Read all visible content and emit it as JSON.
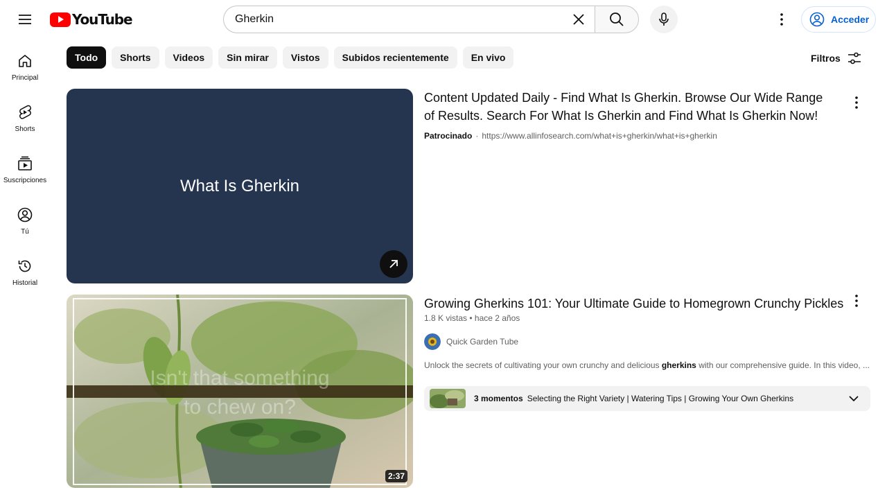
{
  "header": {
    "logo_text": "YouTube",
    "search": {
      "value": "Gherkin"
    },
    "signin_label": "Acceder"
  },
  "sidebar": {
    "items": [
      {
        "label": "Principal",
        "icon": "home-icon"
      },
      {
        "label": "Shorts",
        "icon": "shorts-icon"
      },
      {
        "label": "Suscripciones",
        "icon": "subscriptions-icon"
      },
      {
        "label": "Tú",
        "icon": "you-icon"
      },
      {
        "label": "Historial",
        "icon": "history-icon"
      }
    ]
  },
  "chips": [
    {
      "label": "Todo",
      "active": true
    },
    {
      "label": "Shorts"
    },
    {
      "label": "Videos"
    },
    {
      "label": "Sin mirar"
    },
    {
      "label": "Vistos"
    },
    {
      "label": "Subidos recientemente"
    },
    {
      "label": "En vivo"
    }
  ],
  "filters_label": "Filtros",
  "ad": {
    "thumb_title": "What Is Gherkin",
    "headline": "Content Updated Daily - Find What Is Gherkin. Browse Our Wide Range of Results. Search For What Is Gherkin and Find What Is Gherkin Now!",
    "sponsored_label": "Patrocinado",
    "separator": "·",
    "url": "https://www.allinfosearch.com/what+is+gherkin/what+is+gherkin"
  },
  "video": {
    "title": "Growing Gherkins 101: Your Ultimate Guide to Homegrown Crunchy Pickles",
    "meta": "1.8 K vistas • hace 2 años",
    "channel": "Quick Garden Tube",
    "description_before": "Unlock the secrets of cultivating your own crunchy and delicious ",
    "description_bold": "gherkins",
    "description_after": " with our comprehensive guide. In this video, ...",
    "duration": "2:37",
    "thumb_overlay_line1": "Isn't that something",
    "thumb_overlay_line2": "to chew on?",
    "moments_count": "3 momentos",
    "moments_list": "Selecting the Right Variety | Watering Tips | Growing Your Own Gherkins"
  },
  "colors": {
    "accent_red": "#ff0000",
    "link_blue": "#065fd4",
    "ad_thumb_bg": "#253550"
  }
}
